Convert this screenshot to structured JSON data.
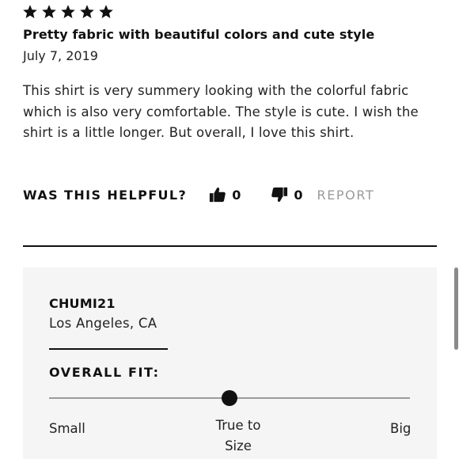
{
  "review": {
    "rating": 5,
    "max_rating": 5,
    "title": "Pretty fabric with beautiful colors and cute style",
    "date": "July 7, 2019",
    "body": "This shirt is very summery looking with the colorful fabric which is also very comfortable. The style is cute. I wish the shirt is a little longer. But overall, I love this shirt."
  },
  "helpful": {
    "label": "WAS THIS HELPFUL?",
    "up_icon": "thumbs-up-icon",
    "up_count": "0",
    "down_icon": "thumbs-down-icon",
    "down_count": "0",
    "report_label": "REPORT"
  },
  "reviewer": {
    "name": "CHUMI21",
    "location": "Los Angeles, CA"
  },
  "fit": {
    "label": "OVERALL FIT:",
    "scale_labels": [
      "Small",
      "True to Size",
      "Big"
    ],
    "value_fraction": 0.5
  },
  "colors": {
    "text": "#111111",
    "muted": "#9a9a9a",
    "panel_bg": "#f5f5f5"
  }
}
